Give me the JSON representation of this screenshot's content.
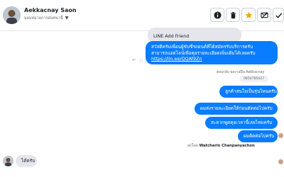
{
  "header": {
    "contact_name": "Aekkacnay Saon",
    "subtitle": "มอบหมายการสนทนานี้",
    "actions": [
      {
        "name": "info-button",
        "icon": "info-icon"
      },
      {
        "name": "delete-button",
        "icon": "trash-icon"
      },
      {
        "name": "star-button",
        "icon": "star-icon"
      },
      {
        "name": "spam-button",
        "icon": "block-mail-icon"
      },
      {
        "name": "done-button",
        "icon": "check-icon"
      }
    ],
    "star_color": "#f0a500"
  },
  "messages": {
    "m1": "LINE Add Friend",
    "m2_line1": "สวัสดีครับเพื่อนผู้ขับขี่รถยนต์ที่ได้สมัครรับบริการครับ",
    "m2_line2": "สามารถแอดไลน์เพื่อคุยรายละเอียดเพิ่มเติมได้เลยครับ",
    "m2_link": "https://lin.ee/QQAf9Zn",
    "reply_meta": "ตอบกลับ ผลงานปืน Aekkacnay",
    "reply_quote": "0850785627",
    "m3": "ลูกค้าสนใจเป็นรุ่นไหนครับ",
    "m4": "ผมส่งรายละเอียดให้ก่อนตัดต่อไปครับ",
    "m5": "สะดวกพูดคุยเวลานี้เลยไหมครับ",
    "m6": "ผมติดต่อไปครับ",
    "sent_by_prefix": "ส่งโดย",
    "sent_by_name": "Watcharin Chanpanyachon",
    "m7": "ได้ครับ"
  },
  "colors": {
    "outgoing": "#0a7cff",
    "incoming": "#e4e6eb"
  }
}
